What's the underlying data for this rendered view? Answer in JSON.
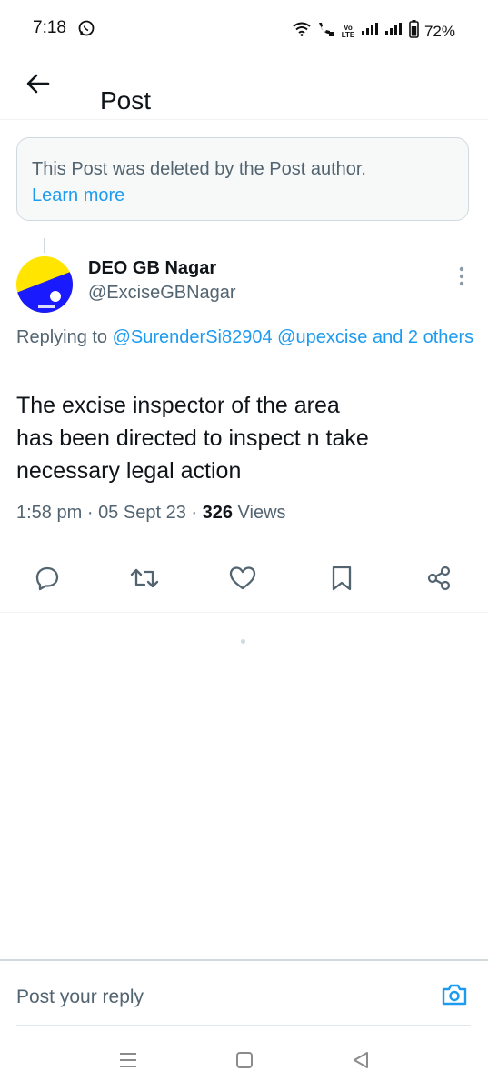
{
  "status_bar": {
    "time": "7:18",
    "battery": "72%",
    "network_label": "Vo LTE",
    "icons": [
      "whatsapp-icon",
      "wifi-icon",
      "wifi-calling-icon",
      "volte-icon",
      "signal-icon",
      "signal-icon",
      "battery-icon"
    ]
  },
  "header": {
    "title": "Post",
    "back_icon": "arrow-left-icon"
  },
  "deleted_notice": {
    "text": "This Post was deleted by the Post author.",
    "link": "Learn more"
  },
  "post": {
    "author_name": "DEO GB Nagar",
    "author_handle": "@ExciseGBNagar",
    "replying_prefix": "Replying to ",
    "mentions": [
      "@SurenderSi82904",
      "@upexcise"
    ],
    "and_others": "and 2 others",
    "body_lines": [
      "The excise inspector of the area",
      "has been directed to inspect n take",
      "necessary legal action"
    ],
    "time": "1:58 pm",
    "separator": "·",
    "date": "05 Sept 23",
    "views_count": "326",
    "views_label": "Views"
  },
  "actions": [
    "reply-icon",
    "retweet-icon",
    "like-icon",
    "bookmark-icon",
    "share-icon"
  ],
  "reply_bar": {
    "placeholder": "Post your reply",
    "camera_icon": "camera-icon"
  },
  "nav": [
    "menu-icon",
    "home-square-icon",
    "back-triangle-icon"
  ],
  "colors": {
    "accent": "#1d9bf0",
    "text_primary": "#0f1419",
    "text_secondary": "#536471",
    "border": "#cfd9de",
    "notice_bg": "#f7f9f9",
    "avatar_yellow": "#ffe500",
    "avatar_blue": "#1a1aff"
  }
}
